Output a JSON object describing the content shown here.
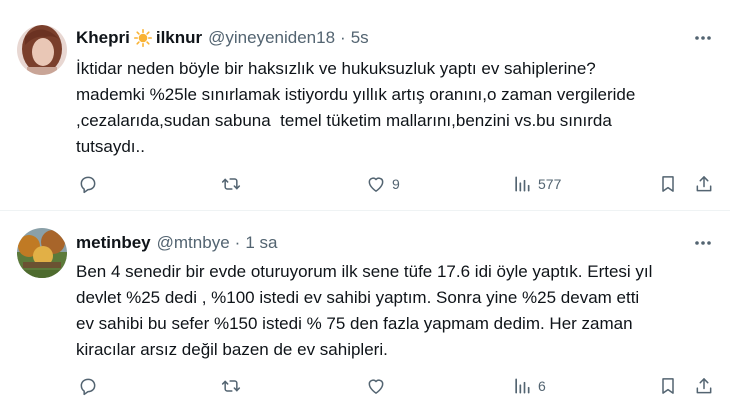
{
  "tweets": [
    {
      "name": "Khepri",
      "name_suffix": "ilknur",
      "handle": "@yineyeniden18",
      "separator": "·",
      "time": "5s",
      "text": "İktidar neden böyle bir haksızlık ve hukuksuzluk yaptı ev sahiplerine?\nmademki %25le sınırlamak istiyordu yıllık artış oranını,o zaman vergileride\n,cezalarıda,sudan sabuna  temel tüketim mallarını,benzini vs.bu sınırda\ntutsaydı..",
      "reply_count": "",
      "retweet_count": "",
      "like_count": "9",
      "view_count": "577"
    },
    {
      "name": "metinbey",
      "handle": "@mtnbye",
      "separator": "·",
      "time": "1 sa",
      "text": "Ben 4 senedir bir evde oturuyorum ilk sene tüfe 17.6 idi öyle yaptık. Ertesi yıl\ndevlet %25 dedi , %100 istedi ev sahibi yaptım. Sonra yine %25 devam etti\nev sahibi bu sefer %150 istedi % 75 den fazla yapmam dedim. Her zaman\nkiracılar arsız değil bazen de ev sahipleri.",
      "reply_count": "",
      "retweet_count": "",
      "like_count": "",
      "view_count": "6"
    }
  ],
  "colors": {
    "text": "#0f1419",
    "secondary": "#536471",
    "divider": "#eff3f4",
    "sun": "#f9b233"
  }
}
